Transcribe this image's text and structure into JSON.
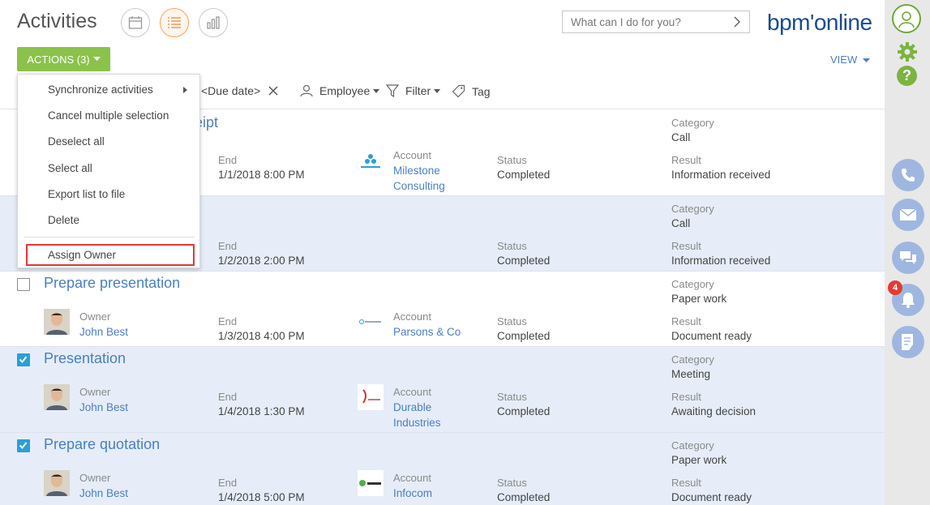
{
  "header": {
    "title": "Activities",
    "search_placeholder": "What can I do for you?",
    "logo_text": "bpm'online",
    "actions_label": "ACTIONS (3)",
    "view_label": "VIEW"
  },
  "filters": {
    "due_date": "<Due date>",
    "employee": "Employee",
    "filter": "Filter",
    "tag": "Tag"
  },
  "actions_menu": {
    "items": [
      {
        "label": "Synchronize activities",
        "has_submenu": true
      },
      {
        "label": "Cancel multiple selection"
      },
      {
        "label": "Deselect all"
      },
      {
        "label": "Select all"
      },
      {
        "label": "Export list to file"
      },
      {
        "label": "Delete"
      },
      {
        "label": "Assign Owner",
        "highlighted": true
      }
    ]
  },
  "labels": {
    "owner": "Owner",
    "end": "End",
    "account": "Account",
    "status": "Status",
    "category": "Category",
    "result": "Result"
  },
  "rows": [
    {
      "title_fragment": "eipt",
      "end": "1/1/2018 8:00 PM",
      "account_line1": "Milestone",
      "account_line2": "Consulting",
      "status": "Completed",
      "category": "Call",
      "result": "Information received",
      "selected": false
    },
    {
      "end": "1/2/2018 2:00 PM",
      "status": "Completed",
      "category": "Call",
      "result": "Information received",
      "selected": true
    },
    {
      "title": "Prepare presentation",
      "owner": "John Best",
      "end": "1/3/2018 4:00 PM",
      "account_line1": "Parsons & Co",
      "status": "Completed",
      "category": "Paper work",
      "result": "Document ready",
      "selected": false
    },
    {
      "title": "Presentation",
      "owner": "John Best",
      "end": "1/4/2018 1:30 PM",
      "account_line1": "Durable",
      "account_line2": "Industries",
      "status": "Completed",
      "category": "Meeting",
      "result": "Awaiting decision",
      "selected": true
    },
    {
      "title": "Prepare quotation",
      "owner": "John Best",
      "end": "1/4/2018 5:00 PM",
      "account_line1": "Infocom",
      "status": "Completed",
      "category": "Paper work",
      "result": "Document ready",
      "selected": true
    }
  ],
  "sidebar": {
    "notification_count": "4",
    "buttons": [
      "profile-icon",
      "gear-icon",
      "help-icon",
      "phone-icon",
      "email-icon",
      "chat-icon",
      "bell-icon",
      "feed-icon"
    ]
  },
  "colors": {
    "accent_green": "#8ac24a",
    "link_blue": "#4a7fc1",
    "selected_row": "#e6edf8",
    "sidebar_button": "#9fb7e0",
    "highlight_red": "#e0373d"
  }
}
